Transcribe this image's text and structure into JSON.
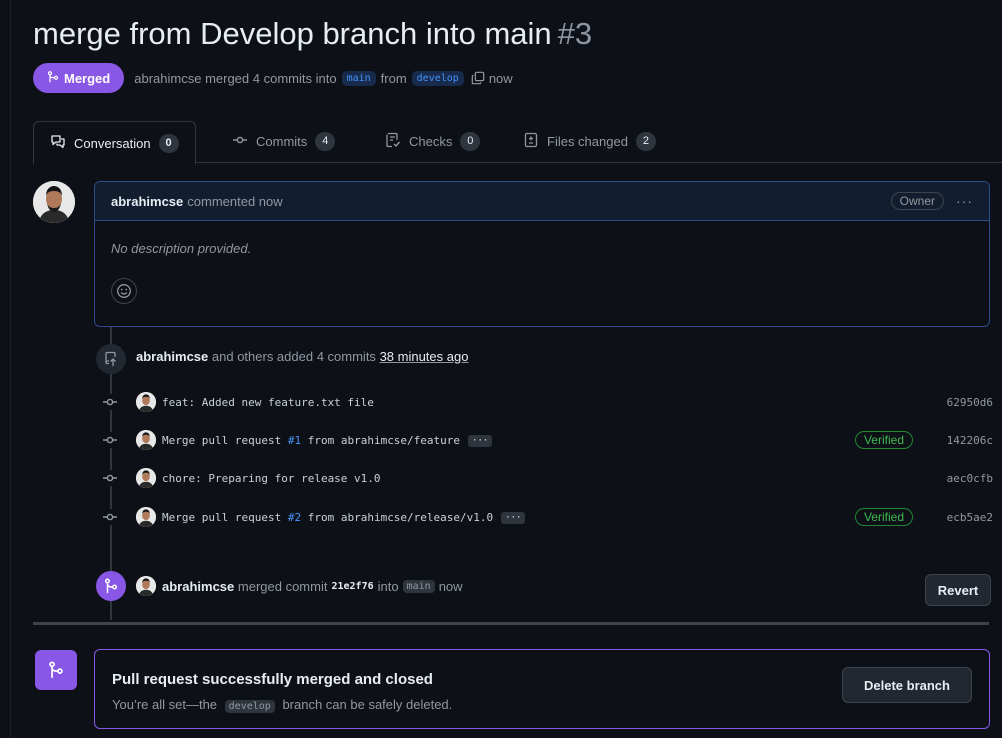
{
  "pr": {
    "title": "merge from Develop branch into main",
    "number": "#3",
    "state": "Merged",
    "meta": {
      "author": "abrahimcse",
      "merged_text": "merged 4 commits into",
      "base_branch": "main",
      "from_text": "from",
      "head_branch": "develop",
      "time": "now"
    }
  },
  "tabs": [
    {
      "label": "Conversation",
      "count": "0"
    },
    {
      "label": "Commits",
      "count": "4"
    },
    {
      "label": "Checks",
      "count": "0"
    },
    {
      "label": "Files changed",
      "count": "2"
    }
  ],
  "comment": {
    "author": "abrahimcse",
    "action": "commented now",
    "role": "Owner",
    "more": "···",
    "body": "No description provided."
  },
  "commits_event": {
    "author": "abrahimcse",
    "text": "and others added 4 commits",
    "time": "38 minutes ago"
  },
  "commits": [
    {
      "message": "feat: Added new feature.txt file",
      "sha": "62950d6"
    },
    {
      "message_before": "Merge pull request",
      "pr": "#1",
      "message_after": "from abrahimcse/feature",
      "more": "···",
      "verified": "Verified",
      "sha": "142206c"
    },
    {
      "message": "chore: Preparing for release v1.0",
      "sha": "aec0cfb"
    },
    {
      "message_before": "Merge pull request",
      "pr": "#2",
      "message_after": "from abrahimcse/release/v1.0",
      "more": "···",
      "verified": "Verified",
      "sha": "ecb5ae2"
    }
  ],
  "merge_event": {
    "author": "abrahimcse",
    "text": "merged commit",
    "sha": "21e2f76",
    "into": "into",
    "branch": "main",
    "time": "now",
    "revert_label": "Revert"
  },
  "merge_box": {
    "title": "Pull request successfully merged and closed",
    "sub_before": "You’re all set—the",
    "branch": "develop",
    "sub_after": "branch can be safely deleted.",
    "delete_label": "Delete branch"
  },
  "colors": {
    "accent_purple": "#8957e5",
    "verified_green": "#3fb950",
    "link_blue": "#4493f8",
    "background": "#0d1117"
  }
}
